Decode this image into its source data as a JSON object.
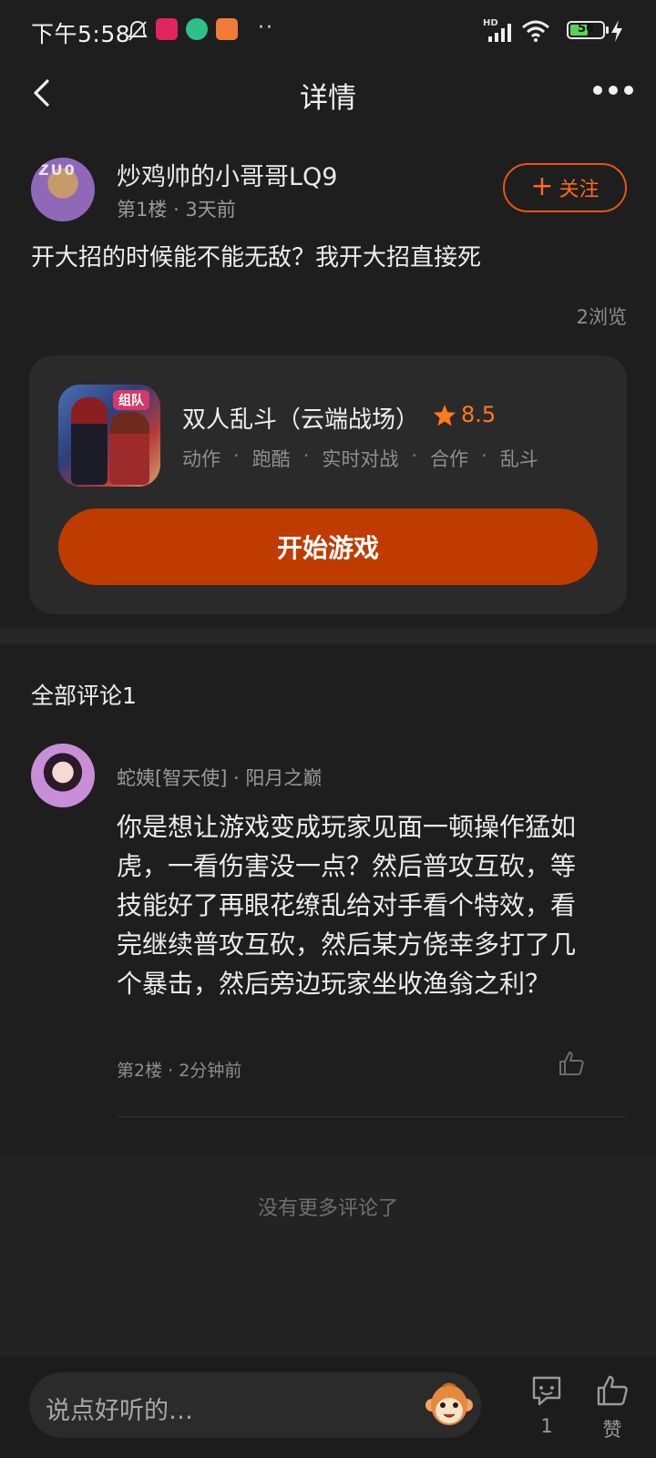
{
  "status_bar": {
    "time": "下午5:58",
    "dots": "··",
    "battery": "56",
    "battery_level": 0.56,
    "network": "HD"
  },
  "nav": {
    "title": "详情"
  },
  "post": {
    "author": "炒鸡帅的小哥哥LQ9",
    "floor": "第1楼",
    "time": "3天前",
    "follow_label": "关注",
    "content": "开大招的时候能不能无敌？我开大招直接死",
    "views": "2浏览"
  },
  "game_card": {
    "title": "双人乱斗（云端战场）",
    "rating": "8.5",
    "icon_tag": "组队",
    "tags": [
      "动作",
      "跑酷",
      "实时对战",
      "合作",
      "乱斗"
    ],
    "play_label": "开始游戏"
  },
  "comments": {
    "title": "全部评论1",
    "items": [
      {
        "user": "蛇姨[智天使] · 阳月之巅",
        "body": "你是想让游戏变成玩家见面一顿操作猛如虎，一看伤害没一点？然后普攻互砍，等技能好了再眼花缭乱给对手看个特效，看完继续普攻互砍，然后某方侥幸多打了几个暴击，然后旁边玩家坐收渔翁之利？",
        "floor": "第2楼",
        "time": "2分钟前"
      }
    ],
    "no_more": "没有更多评论了"
  },
  "bottom_bar": {
    "input_placeholder": "说点好听的…",
    "comment_count": "1",
    "like_label": "赞"
  },
  "colors": {
    "accent": "#ff6a1a",
    "play_button": "#bf3b00",
    "background": "#1e1e1e",
    "card": "#2a2a2a"
  }
}
